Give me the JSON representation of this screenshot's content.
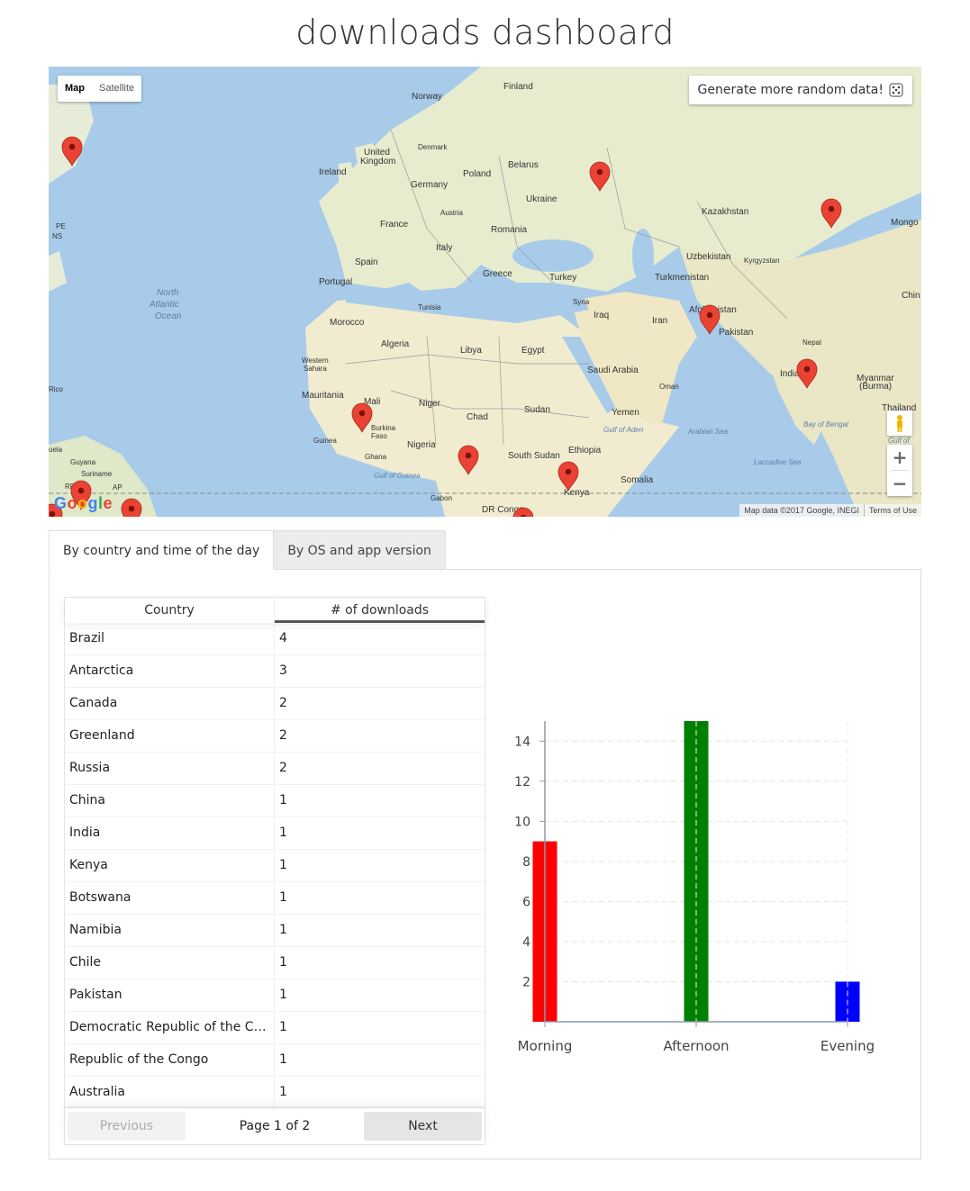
{
  "page": {
    "title": "downloads dashboard"
  },
  "map": {
    "map_type_buttons": [
      "Map",
      "Satellite"
    ],
    "generate_button": "Generate more random data!",
    "zoom_in": "+",
    "zoom_out": "−",
    "footer": {
      "data": "Map data ©2017 Google, INEGI",
      "terms": "Terms of Use"
    },
    "logo": "Google",
    "labels": [
      "Finland",
      "Norway",
      "Denmark",
      "United Kingdom",
      "Ireland",
      "Belarus",
      "Poland",
      "Germany",
      "Ukraine",
      "Austria",
      "France",
      "Romania",
      "Kazakhstan",
      "Mongo",
      "Italy",
      "Spain",
      "Portugal",
      "Greece",
      "Turkey",
      "Uzbekistan",
      "Kyrgyzstan",
      "Turkmenistan",
      "North Atlantic Ocean",
      "Tunisia",
      "Syria",
      "Iraq",
      "Iran",
      "Afghanistan",
      "Pakistan",
      "Chin",
      "Morocco",
      "Algeria",
      "Libya",
      "Egypt",
      "Nepal",
      "Western Sahara",
      "Saudi Arabia",
      "India",
      "Myanmar (Burma)",
      "Oman",
      "Mauritania",
      "Mali",
      "Niger",
      "Sudan",
      "Chad",
      "Yemen",
      "Thailand",
      "Gulf of Aden",
      "Arabian Sea",
      "Bay of Bengal",
      "Burkina Faso",
      "Guinea",
      "Nigeria",
      "Ghana",
      "Ethiopia",
      "South Sudan",
      "Somalia",
      "Kenya",
      "Gulf of Guinea",
      "Laccadive Sea",
      "Gabon",
      "DR Congo",
      "Guyana",
      "Suriname",
      "PE",
      "NS",
      "Rico",
      "uela",
      "AP",
      "RR",
      "Gulf of"
    ]
  },
  "tabs": [
    "By country and time of the day",
    "By OS and app version"
  ],
  "table": {
    "headers": [
      "Country",
      "# of downloads"
    ],
    "rows": [
      [
        "Brazil",
        "4"
      ],
      [
        "Antarctica",
        "3"
      ],
      [
        "Canada",
        "2"
      ],
      [
        "Greenland",
        "2"
      ],
      [
        "Russia",
        "2"
      ],
      [
        "China",
        "1"
      ],
      [
        "India",
        "1"
      ],
      [
        "Kenya",
        "1"
      ],
      [
        "Botswana",
        "1"
      ],
      [
        "Namibia",
        "1"
      ],
      [
        "Chile",
        "1"
      ],
      [
        "Pakistan",
        "1"
      ],
      [
        "Democratic Republic of the Con...",
        "1"
      ],
      [
        "Republic of the Congo",
        "1"
      ],
      [
        "Australia",
        "1"
      ]
    ],
    "pager": {
      "previous": "Previous",
      "info": "Page 1 of 2",
      "next": "Next"
    }
  },
  "chart_data": {
    "type": "bar",
    "categories": [
      "Morning",
      "Afternoon",
      "Evening"
    ],
    "values": [
      9,
      15,
      2
    ],
    "colors": [
      "#ff0000",
      "#008000",
      "#0000ff"
    ],
    "ylim": [
      0,
      15
    ],
    "yticks": [
      2,
      4,
      6,
      8,
      10,
      12,
      14
    ],
    "grid": true
  }
}
